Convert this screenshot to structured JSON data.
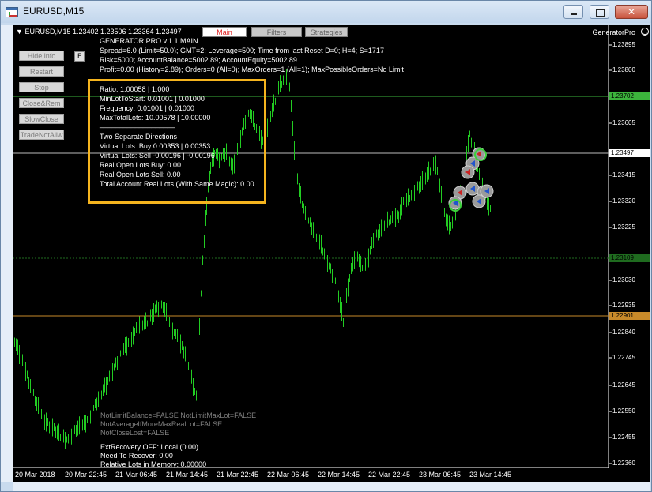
{
  "window": {
    "title": "EURUSD,M15",
    "buttons": {
      "minimize": "minimize",
      "maximize": "maximize",
      "close": "✕"
    }
  },
  "chart": {
    "header": "EURUSD,M15  1.23402 1.23506 1.23364 1.23497",
    "expert_name": "GeneratorPro",
    "tabs": [
      {
        "label": "Main",
        "active": true
      },
      {
        "label": "Filters",
        "active": false
      },
      {
        "label": "Strategies",
        "active": false
      }
    ],
    "side_buttons": [
      "Hide info",
      "Restart",
      "Stop",
      "Close&Rem",
      "SlowClose",
      "TradeNotAllw"
    ],
    "f_button": "F",
    "info_lines": [
      "GENERATOR PRO v.1.1  MAIN",
      "Spread=6.0 (Limit=50.0);    GMT=2;    Leverage=500;    Time from last Reset D=0; H=4; S=1717",
      "Risk=5000;    AccountBalance=5002.89; AccountEquity=5002.89",
      "Profit=0.00 (History=2.89);    Orders=0 (All=0);     MaxOrders=1 (All=1);     MaxPossibleOrders=No Limit"
    ],
    "box_lines": [
      "Ratio:              1.00058  |  1.000",
      "MinLotToStart:    0.01001  |  0.01000",
      "Frequency:        0.01001  |  0.01000",
      "MaxTotalLots:    10.00578  |  10.00000",
      "___________________",
      "Two Separate Directions",
      "Virtual Lots:  Buy    0.00353  |  0.00353",
      "Virtual Lots:  Sell  -0.00196  |  -0.00196",
      "Real Open Lots Buy: 0.00",
      "Real Open Lots Sell: 0.00",
      "Total Account Real Lots (With Same Magic): 0.00"
    ],
    "flags_lines": [
      "NotLimitBalance=FALSE      NotLimitMaxLot=FALSE",
      "NotAverageIfMoreMaxRealLot=FALSE",
      "NotCloseLost=FALSE"
    ],
    "recovery_lines": [
      "ExtRecovery OFF: Local (0.00)",
      "Need To Recover: 0.00",
      "Relative Lots in Memory: 0.00000"
    ],
    "price_ticks": [
      "1.23895",
      "1.23800",
      "1.23605",
      "1.23415",
      "1.23320",
      "1.23225",
      "1.23030",
      "1.22935",
      "1.22840",
      "1.22745",
      "1.22645",
      "1.22550",
      "1.22455",
      "1.22360"
    ],
    "price_labels": [
      {
        "text": "1.23702",
        "color": "#3cb43c",
        "text_color": "#000000"
      },
      {
        "text": "1.23497",
        "color": "#ffffff",
        "text_color": "#000000"
      },
      {
        "text": "1.23109",
        "color": "#1f6b1f",
        "text_color": "#000000"
      },
      {
        "text": "1.22901",
        "color": "#c88a2a",
        "text_color": "#000000"
      }
    ],
    "time_ticks": [
      "20 Mar 2018",
      "20 Mar 22:45",
      "21 Mar 06:45",
      "21 Mar 14:45",
      "21 Mar 22:45",
      "22 Mar 06:45",
      "22 Mar 14:45",
      "22 Mar 22:45",
      "23 Mar 06:45",
      "23 Mar 14:45"
    ],
    "colors": {
      "background": "#000000",
      "candles": "#22cc22",
      "highlight_box": "#f5b41e"
    }
  }
}
